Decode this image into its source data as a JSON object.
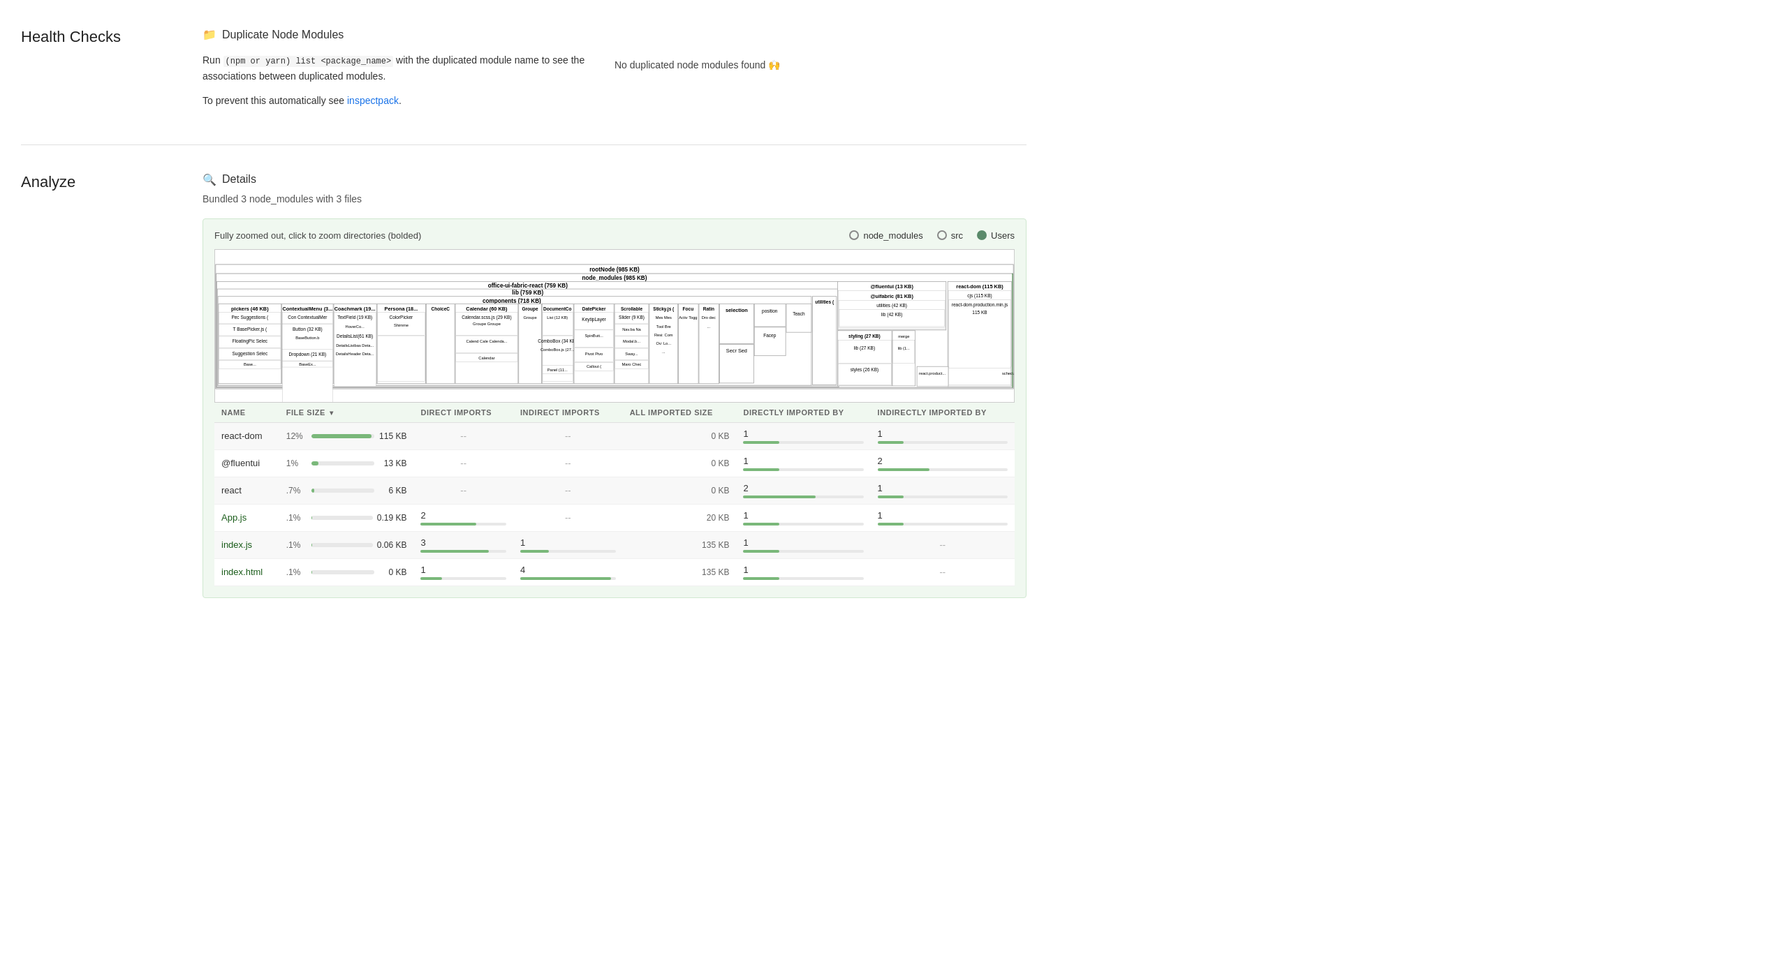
{
  "healthChecks": {
    "sectionTitle": "Health Checks",
    "item": {
      "iconLabel": "folder-icon",
      "title": "Duplicate Node Modules",
      "descriptionLine1": "Run ",
      "code": "(npm or yarn) list <package_name>",
      "descriptionLine2": " with the duplicated module name to see the associations between duplicated modules.",
      "descriptionLine3": "To prevent this automatically see ",
      "link": "inspectpack",
      "descriptionLine4": ".",
      "status": "No duplicated node modules found 🙌"
    }
  },
  "analyze": {
    "sectionTitle": "Analyze",
    "header": {
      "icon": "🔍",
      "title": "Details"
    },
    "subtitle": "Bundled 3 node_modules with 3 files"
  },
  "treemap": {
    "hint": "Fully zoomed out, click to zoom directories (bolded)",
    "legend": [
      {
        "label": "node_modules",
        "type": "outline"
      },
      {
        "label": "src",
        "type": "outline"
      },
      {
        "label": "Users",
        "type": "filled"
      }
    ],
    "rootLabel": "rootNode (985 KB)",
    "nodeModulesLabel": "node_modules (985 KB)",
    "officeLabel": "office-ui-fabric-react (759 KB)",
    "libLabel": "lib (759 KB)",
    "componentsLabel": "components (718 KB)"
  },
  "table": {
    "columns": [
      {
        "label": "NAME",
        "key": "name"
      },
      {
        "label": "FILE SIZE ▾",
        "key": "fileSize"
      },
      {
        "label": "DIRECT IMPORTS",
        "key": "directImports"
      },
      {
        "label": "INDIRECT IMPORTS",
        "key": "indirectImports"
      },
      {
        "label": "ALL IMPORTED SIZE",
        "key": "allImportedSize"
      },
      {
        "label": "DIRECTLY IMPORTED BY",
        "key": "directlyImportedBy"
      },
      {
        "label": "INDIRECTLY IMPORTED BY",
        "key": "indirectlyImportedBy"
      }
    ],
    "rows": [
      {
        "name": "react-dom",
        "pct": "12%",
        "size": "115 KB",
        "barPct": 95,
        "directImports": "--",
        "directImportsBar": 0,
        "indirectImports": "--",
        "indirectImportsBar": 0,
        "allImportedSize": "0 KB",
        "directlyImportedBy": "1",
        "directlyImportedByBar": 30,
        "indirectlyImportedBy": "1",
        "indirectlyImportedByBar": 20
      },
      {
        "name": "@fluentui",
        "pct": "1%",
        "size": "13 KB",
        "barPct": 11,
        "directImports": "--",
        "directImportsBar": 0,
        "indirectImports": "--",
        "indirectImportsBar": 0,
        "allImportedSize": "0 KB",
        "directlyImportedBy": "1",
        "directlyImportedByBar": 30,
        "indirectlyImportedBy": "2",
        "indirectlyImportedByBar": 40
      },
      {
        "name": "react",
        "pct": ".7%",
        "size": "6 KB",
        "barPct": 5,
        "directImports": "--",
        "directImportsBar": 0,
        "indirectImports": "--",
        "indirectImportsBar": 0,
        "allImportedSize": "0 KB",
        "directlyImportedBy": "2",
        "directlyImportedByBar": 60,
        "indirectlyImportedBy": "1",
        "indirectlyImportedByBar": 20
      },
      {
        "name": "App.js",
        "pct": ".1%",
        "size": "0.19 KB",
        "barPct": 1,
        "directImports": "2",
        "directImportsBar": 65,
        "indirectImports": "--",
        "indirectImportsBar": 0,
        "allImportedSize": "20 KB",
        "directlyImportedBy": "1",
        "directlyImportedByBar": 30,
        "indirectlyImportedBy": "1",
        "indirectlyImportedByBar": 20
      },
      {
        "name": "index.js",
        "pct": ".1%",
        "size": "0.06 KB",
        "barPct": 1,
        "directImports": "3",
        "directImportsBar": 80,
        "indirectImports": "1",
        "indirectImportsBar": 30,
        "allImportedSize": "135 KB",
        "directlyImportedBy": "1",
        "directlyImportedByBar": 30,
        "indirectlyImportedBy": "--",
        "indirectlyImportedByBar": 0
      },
      {
        "name": "index.html",
        "pct": ".1%",
        "size": "0 KB",
        "barPct": 1,
        "directImports": "1",
        "directImportsBar": 25,
        "indirectImports": "4",
        "indirectImportsBar": 95,
        "allImportedSize": "135 KB",
        "directlyImportedBy": "1",
        "directlyImportedByBar": 30,
        "indirectlyImportedBy": "--",
        "indirectlyImportedByBar": 0
      }
    ]
  }
}
